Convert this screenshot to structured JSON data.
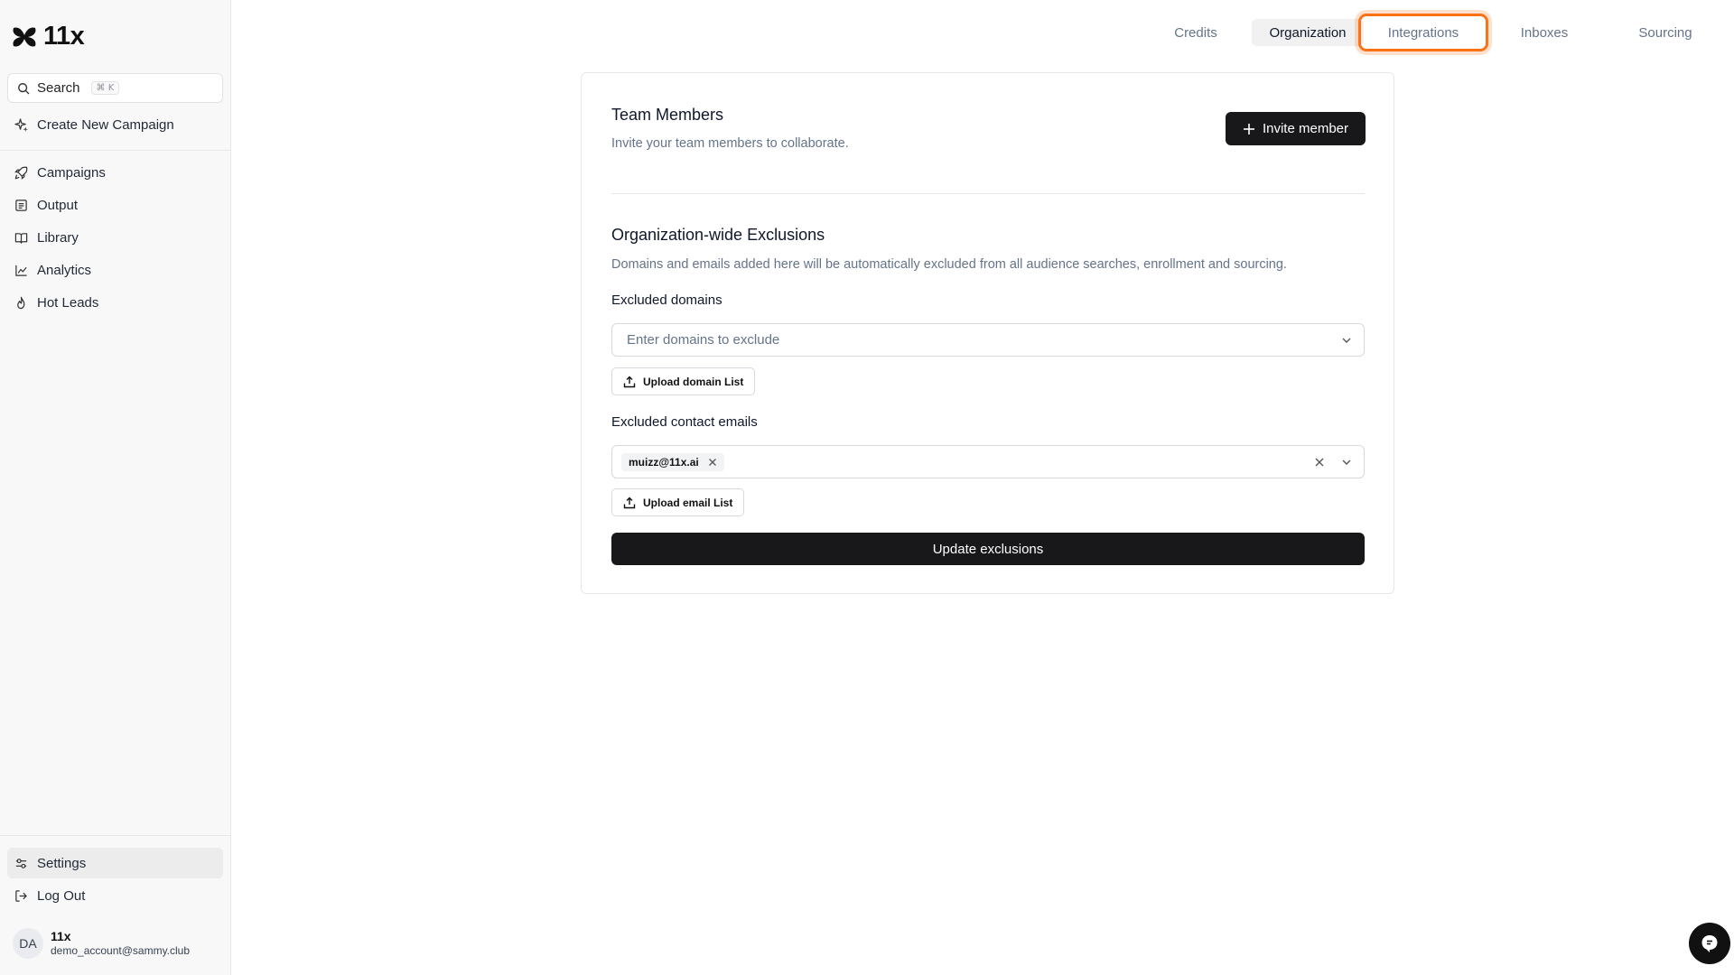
{
  "app": {
    "name": "11x"
  },
  "sidebar": {
    "search_label": "Search",
    "search_shortcut": "⌘ K",
    "create_campaign": "Create New Campaign",
    "items": [
      {
        "label": "Campaigns",
        "icon": "rocket-icon"
      },
      {
        "label": "Output",
        "icon": "list-box-icon"
      },
      {
        "label": "Library",
        "icon": "book-open-icon"
      },
      {
        "label": "Analytics",
        "icon": "line-chart-icon"
      },
      {
        "label": "Hot Leads",
        "icon": "flame-icon"
      }
    ],
    "settings": "Settings",
    "logout": "Log Out",
    "user": {
      "initials": "DA",
      "name": "11x",
      "email": "demo_account@sammy.club"
    }
  },
  "tabs": [
    {
      "label": "Credits",
      "state": "default"
    },
    {
      "label": "Organization",
      "state": "active"
    },
    {
      "label": "Integrations",
      "state": "focused"
    },
    {
      "label": "Inboxes",
      "state": "default"
    },
    {
      "label": "Sourcing",
      "state": "default"
    }
  ],
  "team": {
    "title": "Team Members",
    "description": "Invite your team members to collaborate.",
    "invite_button": "Invite member"
  },
  "exclusions": {
    "title": "Organization-wide Exclusions",
    "description": "Domains and emails added here will be automatically excluded from all audience searches, enrollment and sourcing.",
    "domains_label": "Excluded domains",
    "domains_placeholder": "Enter domains to exclude",
    "upload_domain": "Upload domain List",
    "emails_label": "Excluded contact emails",
    "emails": [
      "muizz@11x.ai"
    ],
    "upload_email": "Upload email List",
    "update_button": "Update exclusions"
  },
  "colors": {
    "focus_ring": "#f97316",
    "primary_button": "#18181b"
  }
}
